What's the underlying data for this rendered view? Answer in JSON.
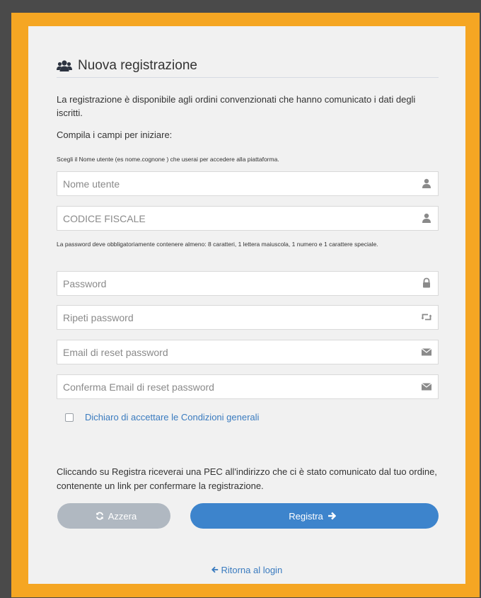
{
  "header": {
    "title": "Nuova registrazione",
    "icon": "users-icon"
  },
  "intro": {
    "text": "La registrazione è disponibile agli ordini convenzionati che hanno comunicato i dati degli iscritti.",
    "compila": "Compila i campi per iniziare:",
    "username_hint": "Scegli il Nome utente (es nome.cognone ) che userai per accedere alla piattaforma.",
    "password_hint": "La password deve obbligatoriamente contenere almeno: 8 caratteri, 1 lettera maiuscola, 1 numero e 1 carattere speciale."
  },
  "fields": {
    "username": {
      "placeholder": "Nome utente",
      "value": "",
      "icon": "user-icon"
    },
    "codice_fiscale": {
      "placeholder": "CODICE FISCALE",
      "value": "",
      "icon": "user-icon"
    },
    "password": {
      "placeholder": "Password",
      "value": "",
      "icon": "lock-icon"
    },
    "repeat_password": {
      "placeholder": "Ripeti password",
      "value": "",
      "icon": "retweet-icon"
    },
    "reset_email": {
      "placeholder": "Email di reset password",
      "value": "",
      "icon": "envelope-icon"
    },
    "confirm_reset_email": {
      "placeholder": "Conferma Email di reset password",
      "value": "",
      "icon": "envelope-icon"
    }
  },
  "terms": {
    "label": "Dichiaro di accettare le Condizioni generali",
    "checked": false
  },
  "pec_notice": "Cliccando su Registra riceverai una PEC all'indirizzo che ci è stato comunicato dal tuo ordine, contenente un link per confermare la registrazione.",
  "buttons": {
    "reset": "Azzera",
    "register": "Registra"
  },
  "back_link": "Ritorna al login",
  "colors": {
    "frame": "#f5a623",
    "primary": "#3d84cc",
    "disabled": "#b0b8c1",
    "link": "#3a7bbf",
    "background": "#4a4a4a"
  }
}
